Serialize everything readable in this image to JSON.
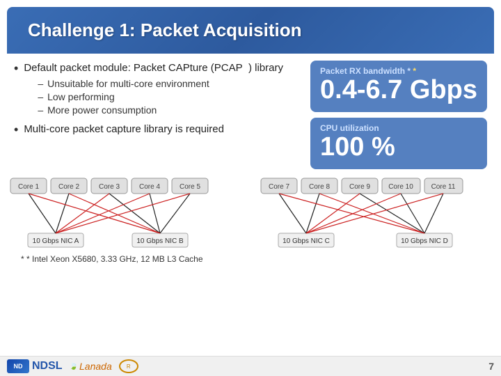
{
  "header": {
    "title": "Challenge 1: Packet Acquisition"
  },
  "content": {
    "bullet1": {
      "text": "Default packet module: Packet CAPture (PCAP",
      "suffix": ") library",
      "subbullets": [
        "Unsuitable for multi-core environment",
        "Low performing",
        "More power consumption"
      ]
    },
    "bullet2": {
      "text": "Multi-core packet capture library is required"
    },
    "info_packet": {
      "label": "Packet RX bandwidth *",
      "value": "0.4-6.7 Gbps"
    },
    "info_cpu": {
      "label": "CPU utilization",
      "value": "100 %"
    }
  },
  "diagram": {
    "cores_left": [
      "Core 1",
      "Core 2",
      "Core 3",
      "Core 4",
      "Core 5"
    ],
    "cores_right": [
      "Core 7",
      "Core 8",
      "Core 9",
      "Core 10",
      "Core 11"
    ],
    "nics_bottom": [
      "10 Gbps NIC A",
      "10 Gbps NIC B",
      "10 Gbps NIC C",
      "10 Gbps NIC D"
    ]
  },
  "footer": {
    "note": "* Intel Xeon X5680, 3.33 GHz, 12 MB L3 Cache",
    "logos": {
      "ndsl": "NDSL",
      "lanada": "Lanada"
    },
    "page_number": "7"
  }
}
